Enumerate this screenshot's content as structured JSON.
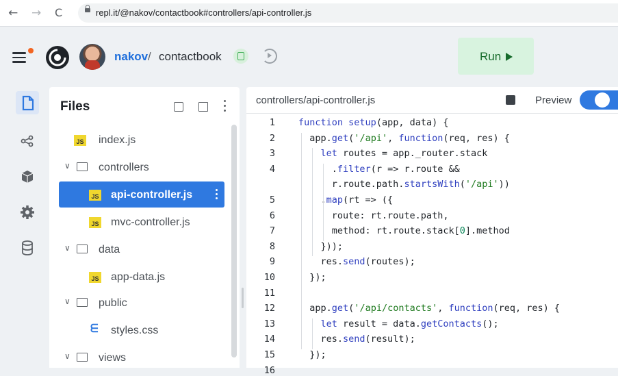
{
  "browser": {
    "back": "←",
    "forward": "→",
    "reload": "C",
    "url": "repl.it/@nakov/contactbook#controllers/api-controller.js"
  },
  "header": {
    "owner": "nakov",
    "separator": "/",
    "project": "contactbook",
    "run_label": "Run"
  },
  "rail": {
    "items": [
      "files-icon",
      "share-icon",
      "packages-icon",
      "settings-icon",
      "database-icon"
    ]
  },
  "files": {
    "title": "Files",
    "tree": [
      {
        "type": "file",
        "icon": "js-icon",
        "name": "index.js",
        "depth": 0
      },
      {
        "type": "folder",
        "name": "controllers",
        "depth": 0
      },
      {
        "type": "file",
        "icon": "js-icon",
        "name": "api-controller.js",
        "depth": 1,
        "selected": true
      },
      {
        "type": "file",
        "icon": "js-icon",
        "name": "mvc-controller.js",
        "depth": 1
      },
      {
        "type": "folder",
        "name": "data",
        "depth": 0
      },
      {
        "type": "file",
        "icon": "js-icon",
        "name": "app-data.js",
        "depth": 1
      },
      {
        "type": "folder",
        "name": "public",
        "depth": 0
      },
      {
        "type": "file",
        "icon": "css-icon",
        "name": "styles.css",
        "depth": 1
      },
      {
        "type": "folder",
        "name": "views",
        "depth": 0
      }
    ]
  },
  "editor": {
    "tab": "controllers/api-controller.js",
    "preview_label": "Preview",
    "preview_on": true,
    "lines": [
      {
        "n": "1",
        "text": "function setup(app, data) {"
      },
      {
        "n": "2",
        "text": "  app.get('/api', function(req, res) {"
      },
      {
        "n": "3",
        "text": "    let routes = app._router.stack"
      },
      {
        "n": "4",
        "text": "      .filter(r => r.route &&"
      },
      {
        "n": "",
        "text": "      r.route.path.startsWith('/api'))"
      },
      {
        "n": "5",
        "text": "    .map(rt => ({"
      },
      {
        "n": "6",
        "text": "      route: rt.route.path,"
      },
      {
        "n": "7",
        "text": "      method: rt.route.stack[0].method"
      },
      {
        "n": "8",
        "text": "    }));"
      },
      {
        "n": "9",
        "text": "    res.send(routes);"
      },
      {
        "n": "10",
        "text": "  });"
      },
      {
        "n": "11",
        "text": ""
      },
      {
        "n": "12",
        "text": "  app.get('/api/contacts', function(req, res) {"
      },
      {
        "n": "13",
        "text": "    let result = data.getContacts();"
      },
      {
        "n": "14",
        "text": "    res.send(result);"
      },
      {
        "n": "15",
        "text": "  });"
      },
      {
        "n": "16",
        "text": ""
      }
    ]
  }
}
